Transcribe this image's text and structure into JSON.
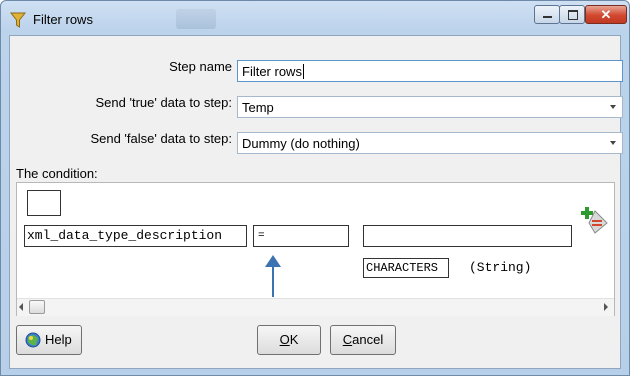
{
  "window": {
    "title": "Filter rows"
  },
  "form": {
    "step_name_label": "Step name",
    "step_name_value": "Filter rows",
    "true_label": "Send 'true' data to step:",
    "true_value": "Temp",
    "false_label": "Send 'false' data to step:",
    "false_value": "Dummy (do nothing)"
  },
  "condition": {
    "heading": "The condition:",
    "field": "xml_data_type_description",
    "operator": "=",
    "value": "",
    "constant": "CHARACTERS",
    "constant_type": "(String)"
  },
  "buttons": {
    "help": "Help",
    "ok_underlined": "O",
    "ok_rest": "K",
    "cancel_underlined": "C",
    "cancel_rest": "ancel"
  },
  "icons": {
    "app": "filter-rows-icon",
    "add_condition": "add-condition-icon",
    "help": "help-icon"
  },
  "colors": {
    "annotation_arrow": "#3b73b2",
    "close_button": "#d2472e",
    "add_icon_plus": "#2e9b2e"
  }
}
